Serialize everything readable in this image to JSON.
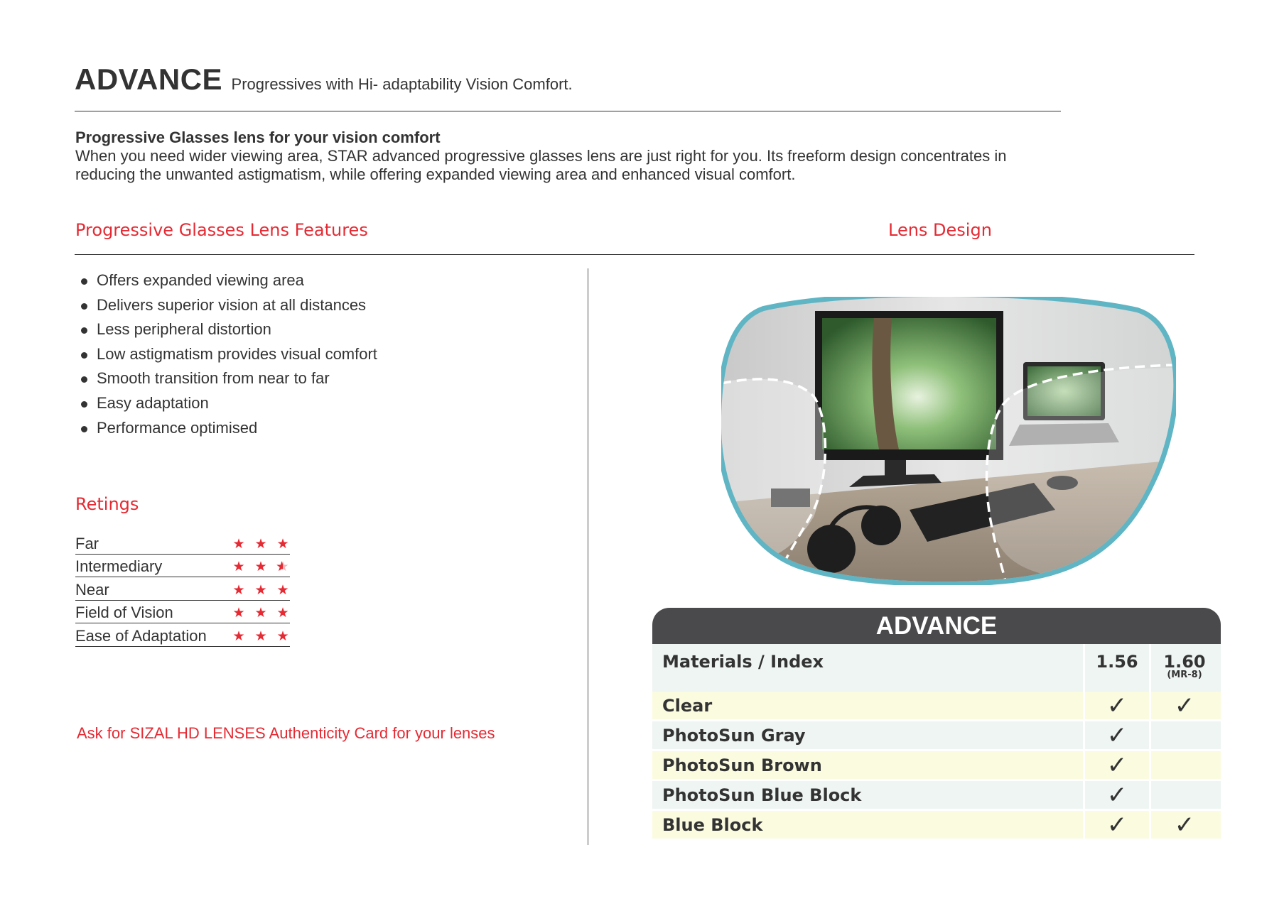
{
  "header": {
    "title": "ADVANCE",
    "subtitle": "Progressives with Hi- adaptability Vision Comfort."
  },
  "intro": {
    "heading": "Progressive Glasses lens for your vision comfort",
    "body": "When you need wider viewing area, STAR advanced progressive glasses lens are just right for you. Its freeform design concentrates in reducing the unwanted astigmatism, while offering expanded viewing area and enhanced visual comfort."
  },
  "sections": {
    "features_label": "Progressive Glasses Lens Features",
    "lens_design_label": "Lens Design",
    "ratings_label": "Retings"
  },
  "features": [
    "Offers expanded viewing area",
    "Delivers superior vision at all distances",
    "Less peripheral distortion",
    "Low astigmatism provides visual comfort",
    "Smooth transition from near to far",
    "Easy adaptation",
    "Performance optimised"
  ],
  "ratings": [
    {
      "name": "Far",
      "stars": 3
    },
    {
      "name": "Intermediary",
      "stars": 2.5
    },
    {
      "name": "Near",
      "stars": 3
    },
    {
      "name": "Field of Vision",
      "stars": 3
    },
    {
      "name": "Ease of Adaptation",
      "stars": 3
    }
  ],
  "authenticity_note": "Ask for SIZAL HD LENSES Authenticity Card for your lenses",
  "table": {
    "title": "ADVANCE",
    "header": {
      "label": "Materials / Index",
      "index_1": "1.56",
      "index_2": "1.60",
      "index_2_note": "(MR-8)"
    },
    "rows": [
      {
        "name": "Clear",
        "idx_156": "✓",
        "idx_160": "✓"
      },
      {
        "name": "PhotoSun Gray",
        "idx_156": "✓",
        "idx_160": ""
      },
      {
        "name": "PhotoSun Brown",
        "idx_156": "✓",
        "idx_160": ""
      },
      {
        "name": "PhotoSun Blue Block",
        "idx_156": "✓",
        "idx_160": ""
      },
      {
        "name": "Blue Block",
        "idx_156": "✓",
        "idx_160": "✓"
      }
    ]
  },
  "colors": {
    "accent_red": "#e52a33",
    "text_dark": "#333333",
    "table_header_bg": "#4a4a4c",
    "row_yellow": "#fbfbe0",
    "row_green": "#eef5f2",
    "lens_rim": "#5fb5c4"
  }
}
